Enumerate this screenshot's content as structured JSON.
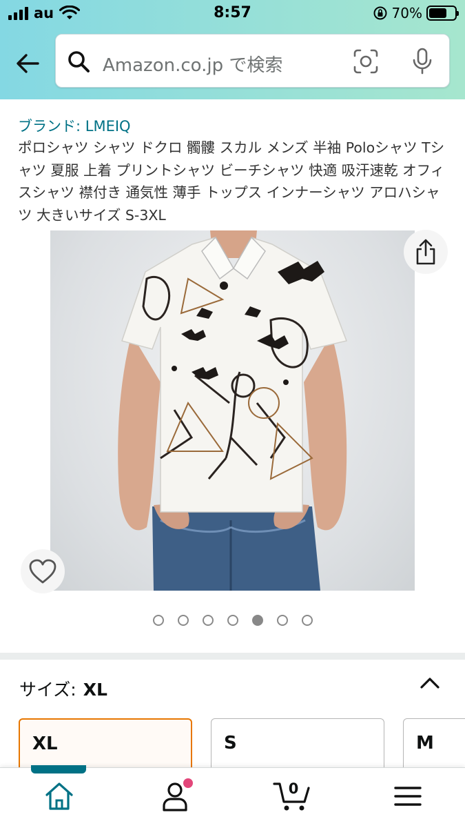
{
  "status_bar": {
    "carrier": "au",
    "time": "8:57",
    "battery_percent": "70%",
    "battery_level": 0.7
  },
  "search": {
    "placeholder": "Amazon.co.jp で検索"
  },
  "product": {
    "brand": "ブランド: LMEIQ",
    "title": "ポロシャツ シャツ ドクロ 髑髏 スカル メンズ 半袖 Poloシャツ Tシャツ 夏服 上着 プリントシャツ ビーチシャツ 快適 吸汗速乾 オフィスシャツ 襟付き 通気性 薄手 トップス インナーシャツ アロハシャツ 大きいサイズ S-3XL",
    "image_count": 7,
    "active_image_index": 4
  },
  "size": {
    "label": "サイズ:",
    "selected": "XL",
    "options": [
      "XL",
      "S",
      "M"
    ]
  },
  "bottom_nav": {
    "items": [
      "home",
      "account",
      "cart",
      "menu"
    ],
    "active": "home",
    "cart_count": "0"
  },
  "colors": {
    "accent_teal": "#007185",
    "selected_orange": "#e77600",
    "notification_pink": "#e3477a"
  },
  "icons": [
    "back-arrow-icon",
    "search-icon",
    "camera-scan-icon",
    "microphone-icon",
    "share-icon",
    "heart-icon",
    "chevron-up-icon",
    "home-icon",
    "account-icon",
    "cart-icon",
    "menu-icon"
  ]
}
